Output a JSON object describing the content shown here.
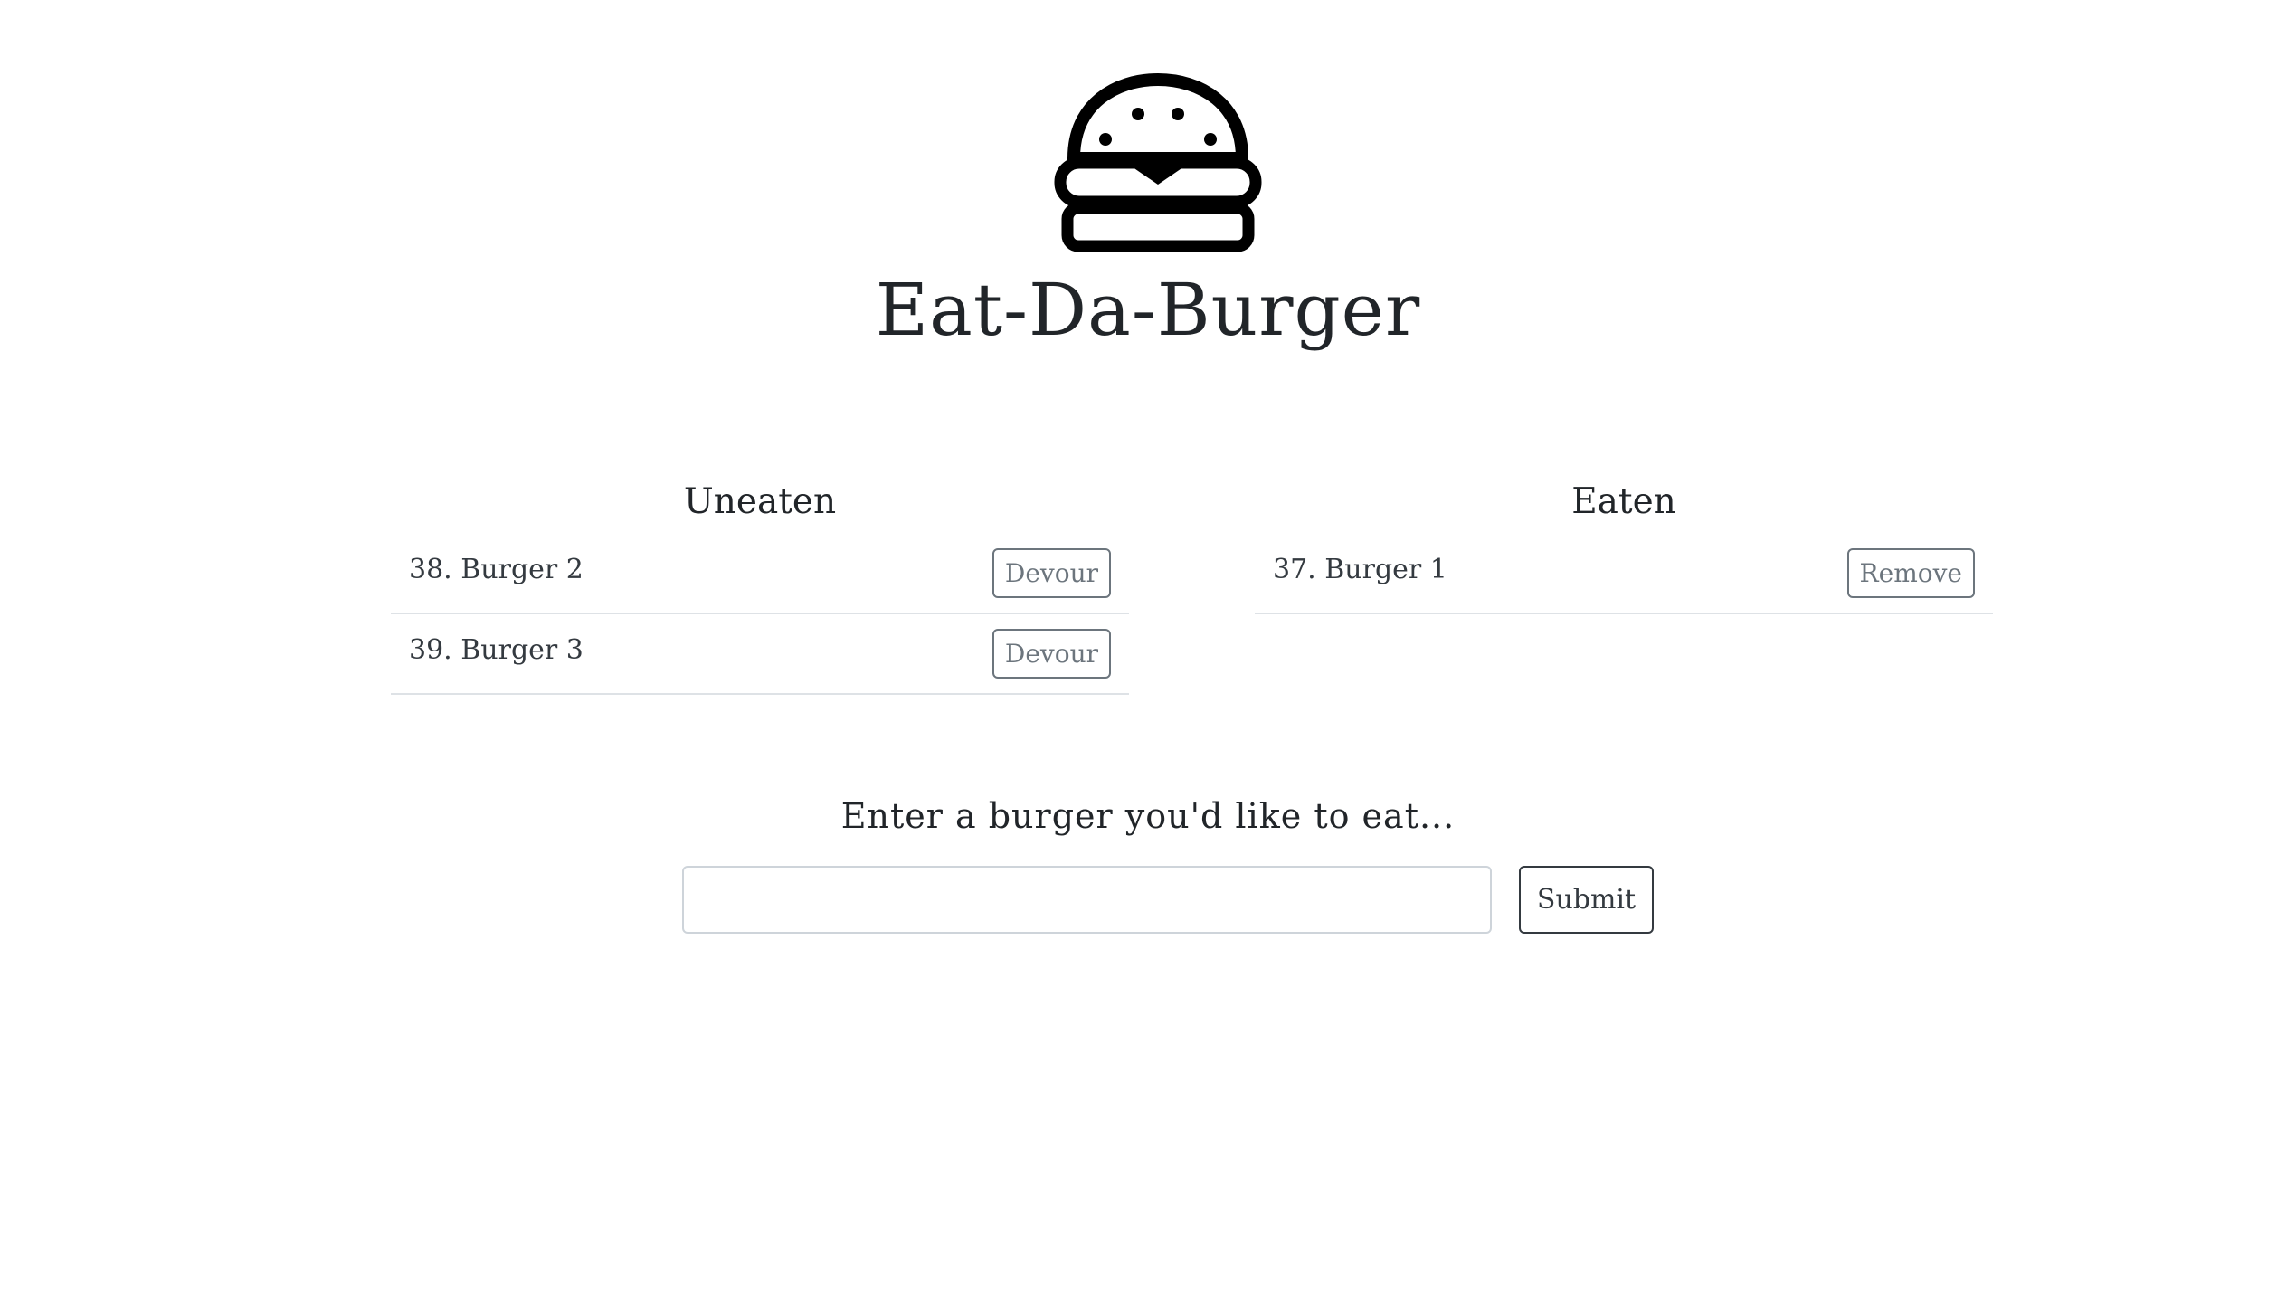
{
  "header": {
    "logo_icon": "burger-icon",
    "title": "Eat-Da-Burger"
  },
  "uneaten": {
    "heading": "Uneaten",
    "items": [
      {
        "label": "38. Burger 2",
        "action": "Devour"
      },
      {
        "label": "39. Burger 3",
        "action": "Devour"
      }
    ]
  },
  "eaten": {
    "heading": "Eaten",
    "items": [
      {
        "label": "37. Burger 1",
        "action": "Remove"
      }
    ]
  },
  "form": {
    "label": "Enter a burger you'd like to eat...",
    "input_value": "",
    "submit_label": "Submit"
  },
  "colors": {
    "text": "#212529",
    "muted_button": "#6c757d",
    "divider": "#dee2e6"
  }
}
